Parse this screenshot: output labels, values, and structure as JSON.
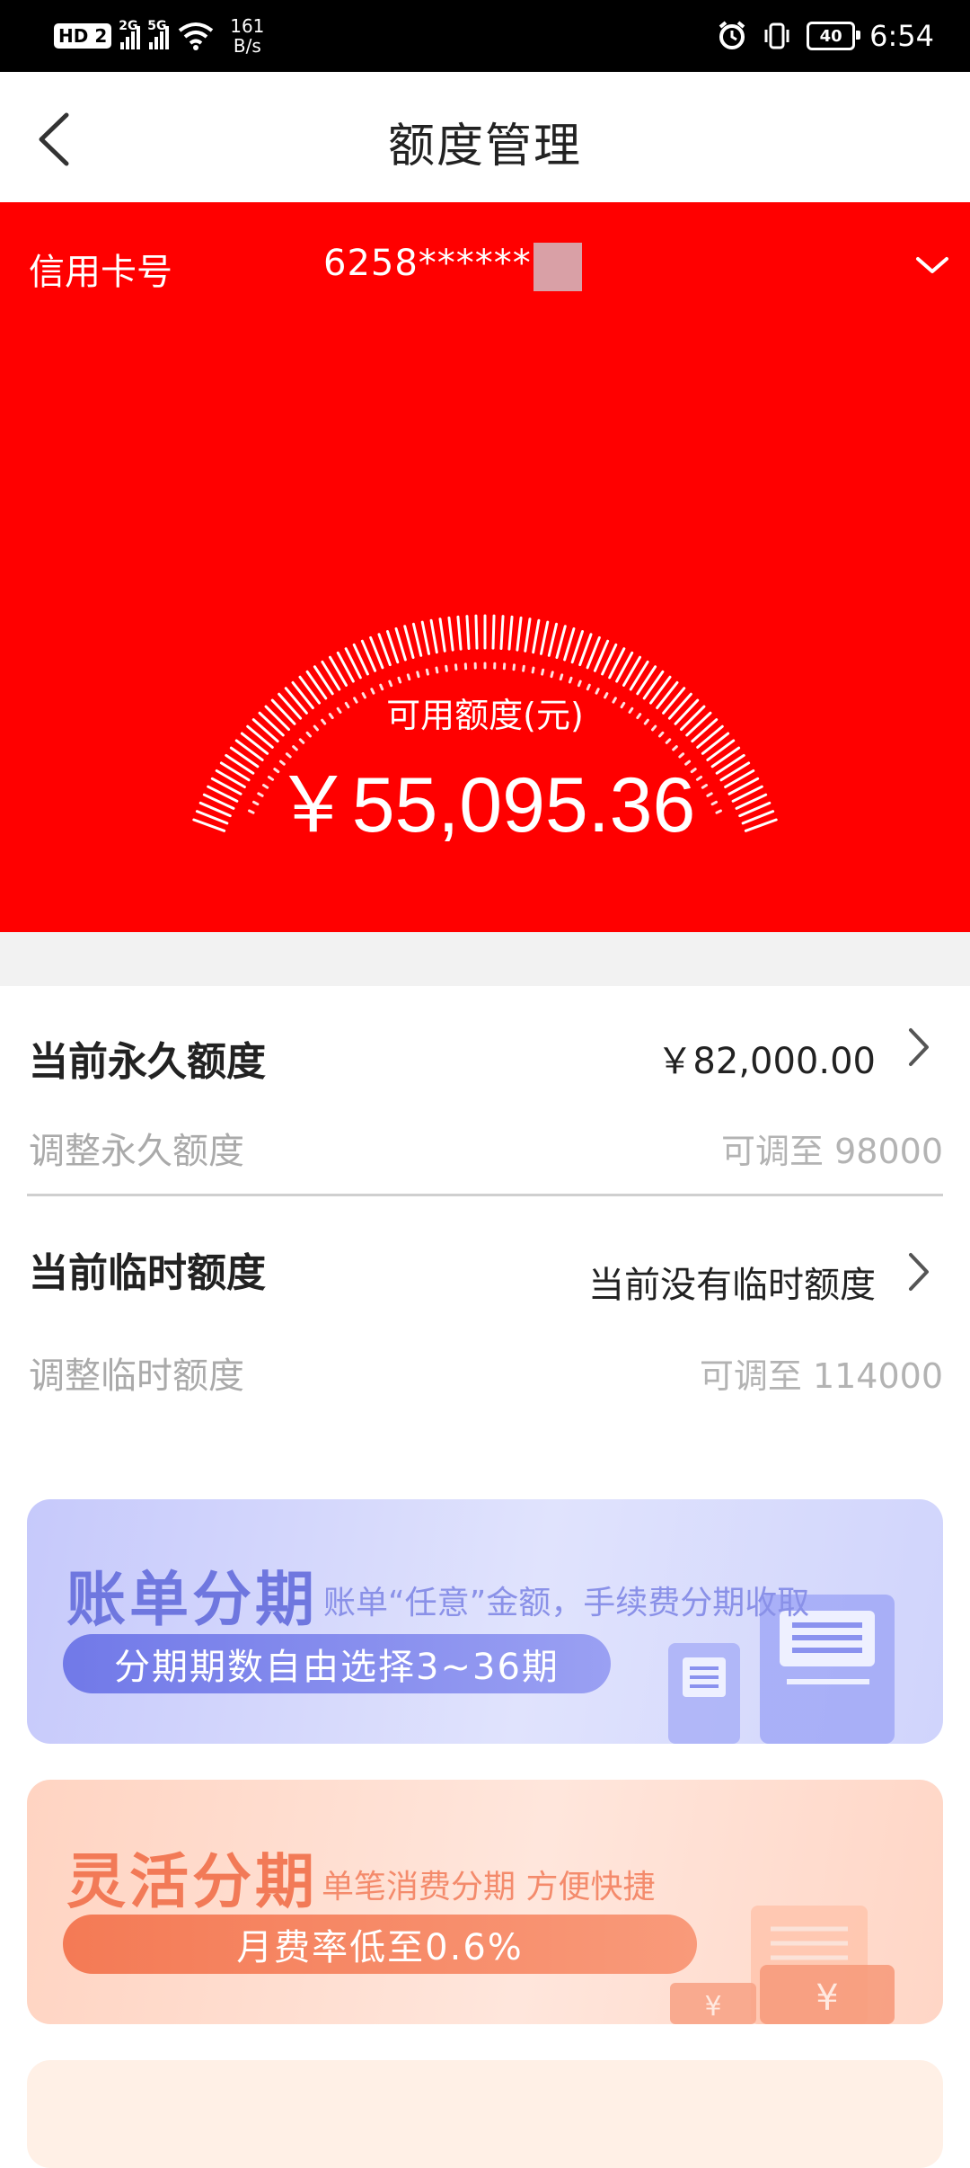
{
  "status_bar": {
    "hd": "HD",
    "sim_index": "2",
    "sig1": "2G",
    "sig2": "5G",
    "speed_value": "161",
    "speed_unit": "B/s",
    "battery": "40",
    "time": "6:54"
  },
  "header": {
    "title": "额度管理"
  },
  "card": {
    "label": "信用卡号",
    "number": "6258******"
  },
  "available": {
    "label": "可用额度(元)",
    "amount": "￥55,095.36"
  },
  "permanent": {
    "title": "当前永久额度",
    "value": "￥82,000.00",
    "adjust_label": "调整永久额度",
    "adjust_value": "可调至 98000"
  },
  "temporary": {
    "title": "当前临时额度",
    "value": "当前没有临时额度",
    "adjust_label": "调整临时额度",
    "adjust_value": "可调至 114000"
  },
  "banners": {
    "bill": {
      "title": "账单分期",
      "subtitle": "账单“任意”金额，手续费分期收取",
      "pill": "分期期数自由选择3~36期"
    },
    "flex": {
      "title": "灵活分期",
      "subtitle": "单笔消费分期 方便快捷",
      "pill": "月费率低至0.6%"
    }
  },
  "colors": {
    "brand_red": "#ff0000",
    "bill_accent": "#6f77df",
    "flex_accent": "#f27a57"
  }
}
